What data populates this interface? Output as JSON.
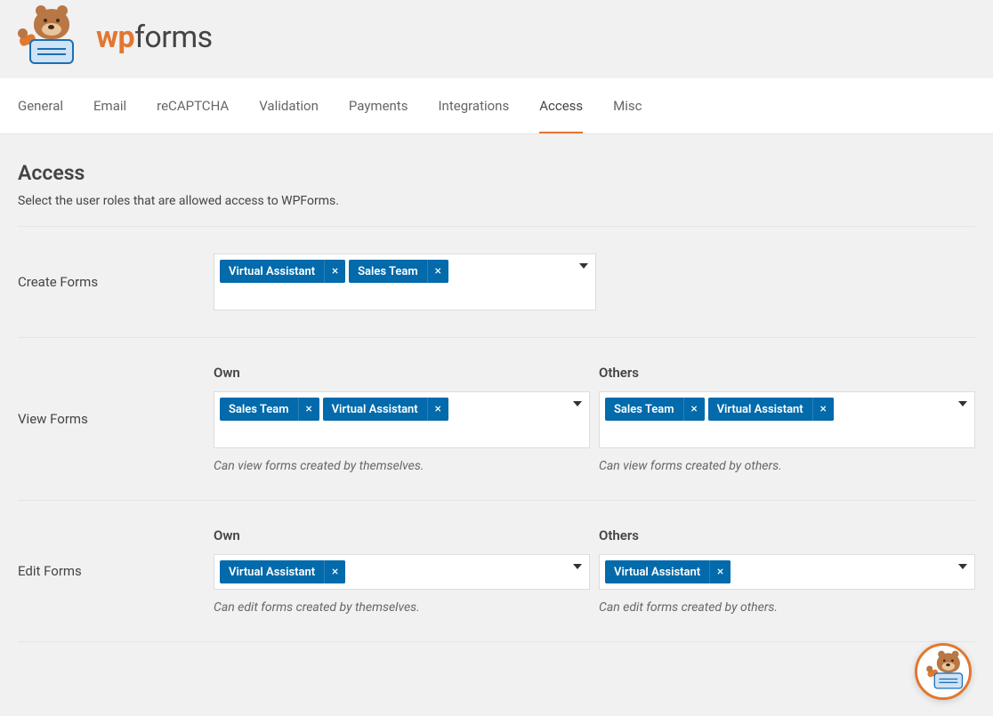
{
  "brand": {
    "wp": "wp",
    "forms": "forms"
  },
  "tabs": {
    "general": "General",
    "email": "Email",
    "recaptcha": "reCAPTCHA",
    "validation": "Validation",
    "payments": "Payments",
    "integrations": "Integrations",
    "access": "Access",
    "misc": "Misc"
  },
  "page": {
    "title": "Access",
    "description": "Select the user roles that are allowed access to WPForms."
  },
  "labels": {
    "own": "Own",
    "others": "Others"
  },
  "sections": {
    "create_forms": {
      "label": "Create Forms",
      "chips": [
        "Virtual Assistant",
        "Sales Team"
      ]
    },
    "view_forms": {
      "label": "View Forms",
      "own": {
        "chips": [
          "Sales Team",
          "Virtual Assistant"
        ],
        "help": "Can view forms created by themselves."
      },
      "others": {
        "chips": [
          "Sales Team",
          "Virtual Assistant"
        ],
        "help": "Can view forms created by others."
      }
    },
    "edit_forms": {
      "label": "Edit Forms",
      "own": {
        "chips": [
          "Virtual Assistant"
        ],
        "help": "Can edit forms created by themselves."
      },
      "others": {
        "chips": [
          "Virtual Assistant"
        ],
        "help": "Can edit forms created by others."
      }
    }
  }
}
